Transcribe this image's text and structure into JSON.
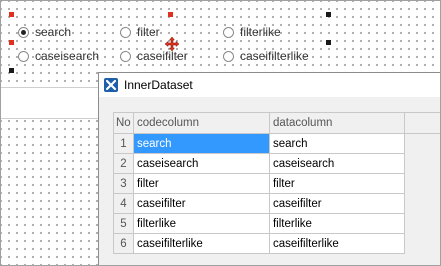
{
  "form": {
    "radios": [
      {
        "label": "search",
        "checked": true
      },
      {
        "label": "filter",
        "checked": false
      },
      {
        "label": "filterlike",
        "checked": false
      },
      {
        "label": "caseisearch",
        "checked": false
      },
      {
        "label": "caseifilter",
        "checked": false
      },
      {
        "label": "caseifilterlike",
        "checked": false
      }
    ]
  },
  "dialog": {
    "title": "InnerDataset",
    "icon": "x-app-icon",
    "grid": {
      "columns": [
        "No",
        "codecolumn",
        "datacolumn"
      ],
      "rows": [
        {
          "no": "1",
          "code": "search",
          "data": "search"
        },
        {
          "no": "2",
          "code": "caseisearch",
          "data": "caseisearch"
        },
        {
          "no": "3",
          "code": "filter",
          "data": "filter"
        },
        {
          "no": "4",
          "code": "caseifilter",
          "data": "caseifilter"
        },
        {
          "no": "5",
          "code": "filterlike",
          "data": "filterlike"
        },
        {
          "no": "6",
          "code": "caseifilterlike",
          "data": "caseifilterlike"
        }
      ]
    }
  },
  "colors": {
    "selection_handle": "#e0301e",
    "handle_dark": "#1a1a1a",
    "selected_cell": "#3399ff",
    "app_icon_bg": "#1e5fa8"
  }
}
